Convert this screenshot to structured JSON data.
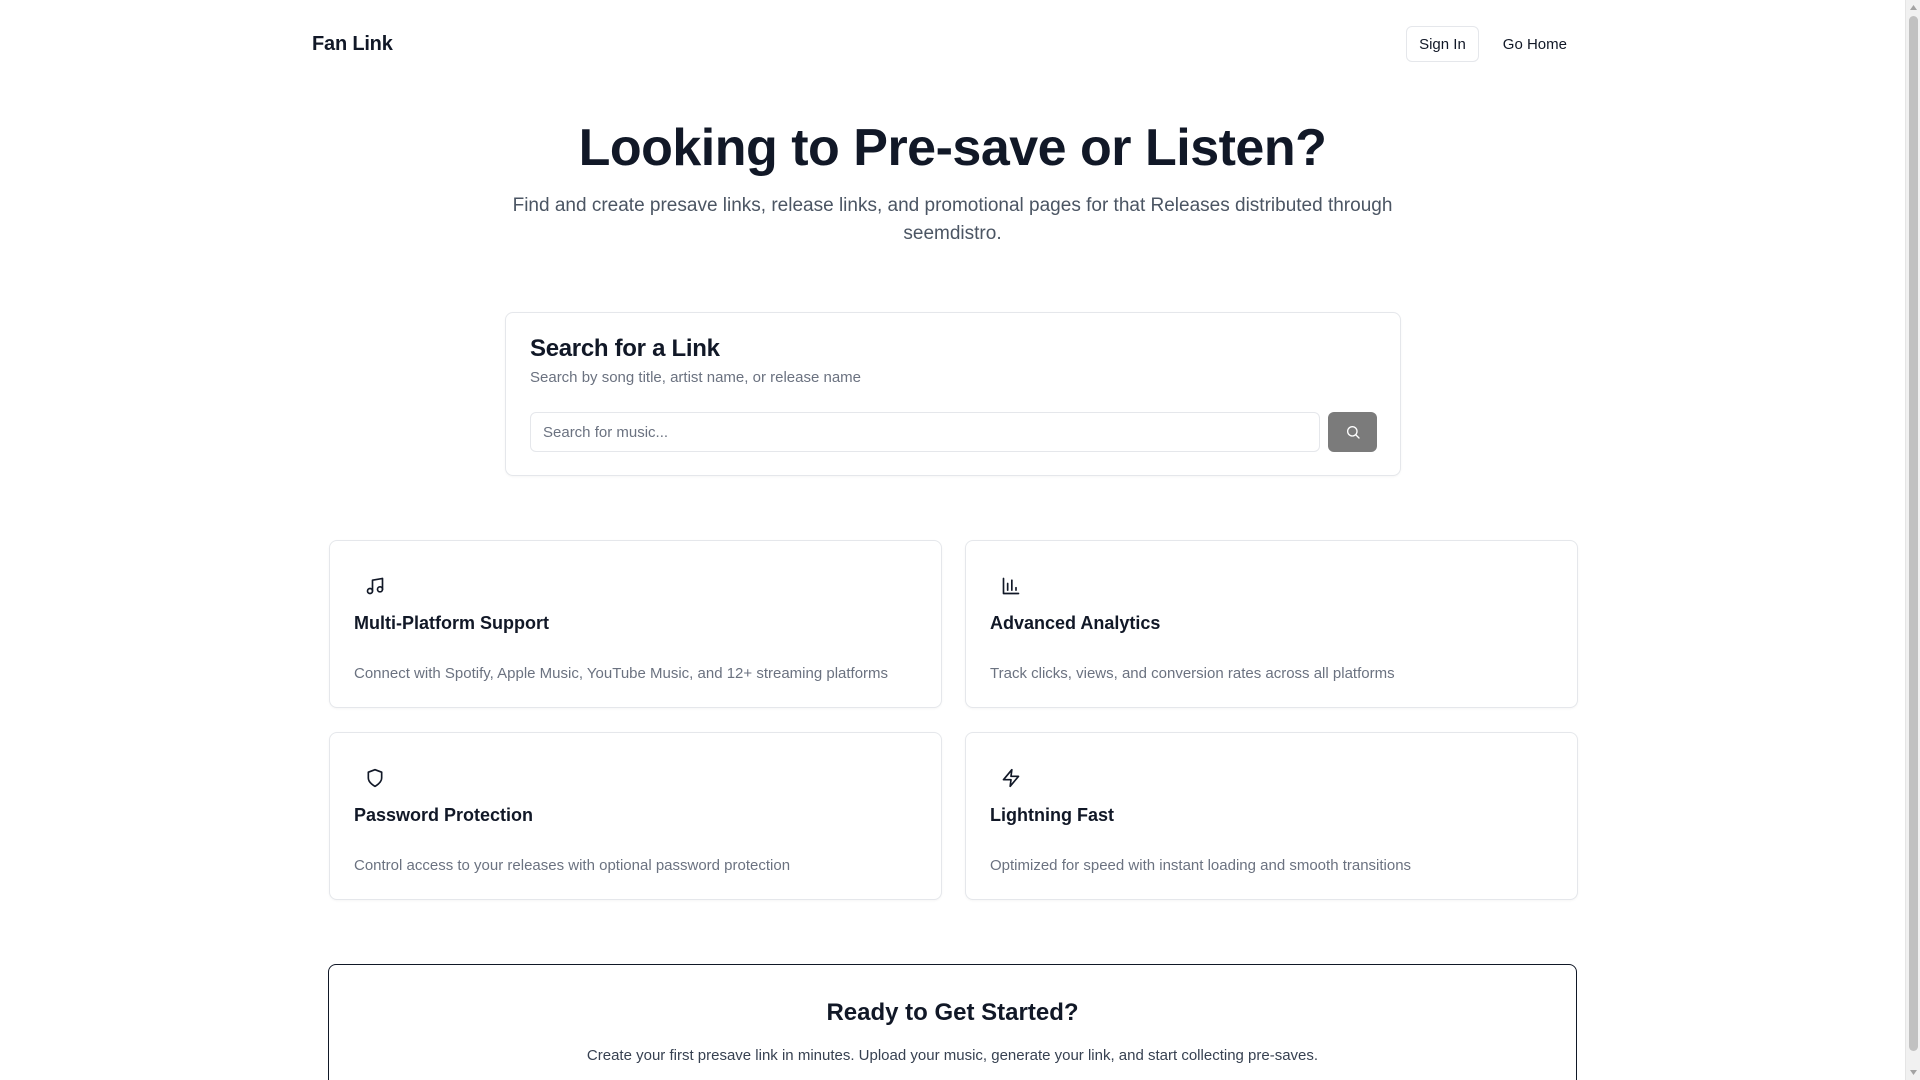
{
  "header": {
    "brand": "Fan Link",
    "sign_in": "Sign In",
    "go_home": "Go Home"
  },
  "hero": {
    "title": "Looking to Pre-save or Listen?",
    "subtitle": "Find and create presave links, release links, and promotional pages for that Releases distributed through seemdistro."
  },
  "search": {
    "title": "Search for a Link",
    "description": "Search by song title, artist name, or release name",
    "placeholder": "Search for music...",
    "button_icon": "search-icon"
  },
  "features": [
    {
      "icon": "music-note-icon",
      "title": "Multi-Platform Support",
      "description": "Connect with Spotify, Apple Music, YouTube Music, and 12+ streaming platforms"
    },
    {
      "icon": "bar-chart-icon",
      "title": "Advanced Analytics",
      "description": "Track clicks, views, and conversion rates across all platforms"
    },
    {
      "icon": "shield-icon",
      "title": "Password Protection",
      "description": "Control access to your releases with optional password protection"
    },
    {
      "icon": "lightning-icon",
      "title": "Lightning Fast",
      "description": "Optimized for speed with instant loading and smooth transitions"
    }
  ],
  "cta": {
    "title": "Ready to Get Started?",
    "description": "Create your first presave link in minutes. Upload your music, generate your link, and start collecting pre-saves."
  },
  "colors": {
    "text_primary": "#111827",
    "text_muted": "#6b7280",
    "border": "#e5e7eb",
    "search_button": "#7b7b7b"
  }
}
